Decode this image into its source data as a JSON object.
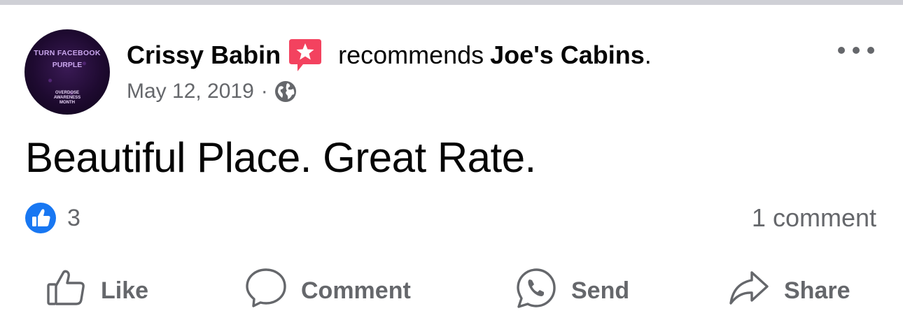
{
  "avatar": {
    "line1": "TURN FACEBOOK",
    "line2": "PURPLE",
    "small": [
      "OVERDOSE",
      "AWARENESS",
      "MONTH"
    ]
  },
  "post": {
    "author": "Crissy Babin",
    "verb": "recommends",
    "page": "Joe's Cabins",
    "period": ".",
    "date": "May 12, 2019",
    "separator": "·",
    "privacy_icon": "globe-icon",
    "text": "Beautiful Place. Great Rate."
  },
  "stats": {
    "reaction_icon": "like-reaction-icon",
    "reaction_count": "3",
    "comment_count": "1 comment"
  },
  "actions": {
    "like": "Like",
    "comment": "Comment",
    "send": "Send",
    "share": "Share"
  },
  "colors": {
    "brand_blue": "#1877f2",
    "recommend_badge": "#f3425f",
    "secondary_text": "#65676b",
    "primary_text": "#050505",
    "top_border": "#cfd0d6"
  }
}
